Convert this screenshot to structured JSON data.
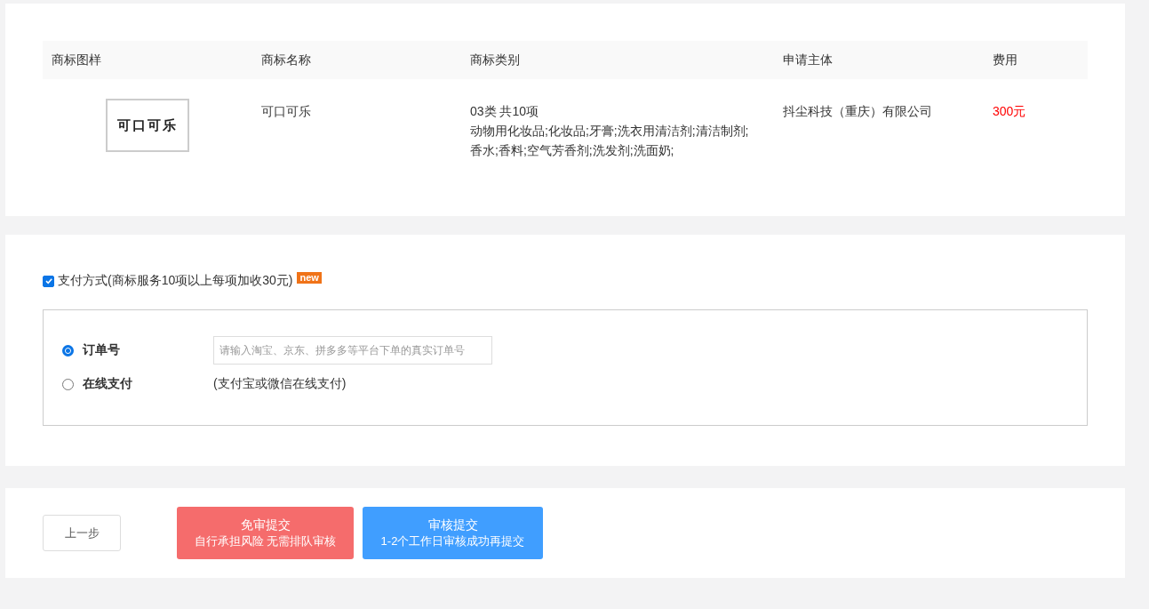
{
  "table": {
    "columns": [
      "商标图样",
      "商标名称",
      "商标类别",
      "申请主体",
      "费用"
    ],
    "rows": [
      {
        "logo_text": "可口可乐",
        "name": "可口可乐",
        "class_summary": "03类 共10项",
        "class_items": "动物用化妆品;化妆品;牙膏;洗衣用清洁剂;清洁制剂;香水;香料;空气芳香剂;洗发剂;洗面奶;",
        "applicant": "抖尘科技（重庆）有限公司",
        "fee": "300元"
      }
    ]
  },
  "payment": {
    "checked": true,
    "label": "支付方式(商标服务10项以上每项加收30元)",
    "badge": "new",
    "options": [
      {
        "kind": "input",
        "label": "订单号",
        "selected": true,
        "placeholder": "请输入淘宝、京东、拼多多等平台下单的真实订单号"
      },
      {
        "kind": "note",
        "label": "在线支付",
        "selected": false,
        "note": "(支付宝或微信在线支付)"
      }
    ]
  },
  "actions": [
    {
      "kind": "plain",
      "title": "上一步"
    },
    {
      "kind": "danger",
      "title": "免审提交",
      "subtitle": "自行承担风险 无需排队审核"
    },
    {
      "kind": "primary",
      "title": "审核提交",
      "subtitle": "1-2个工作日审核成功再提交"
    }
  ]
}
